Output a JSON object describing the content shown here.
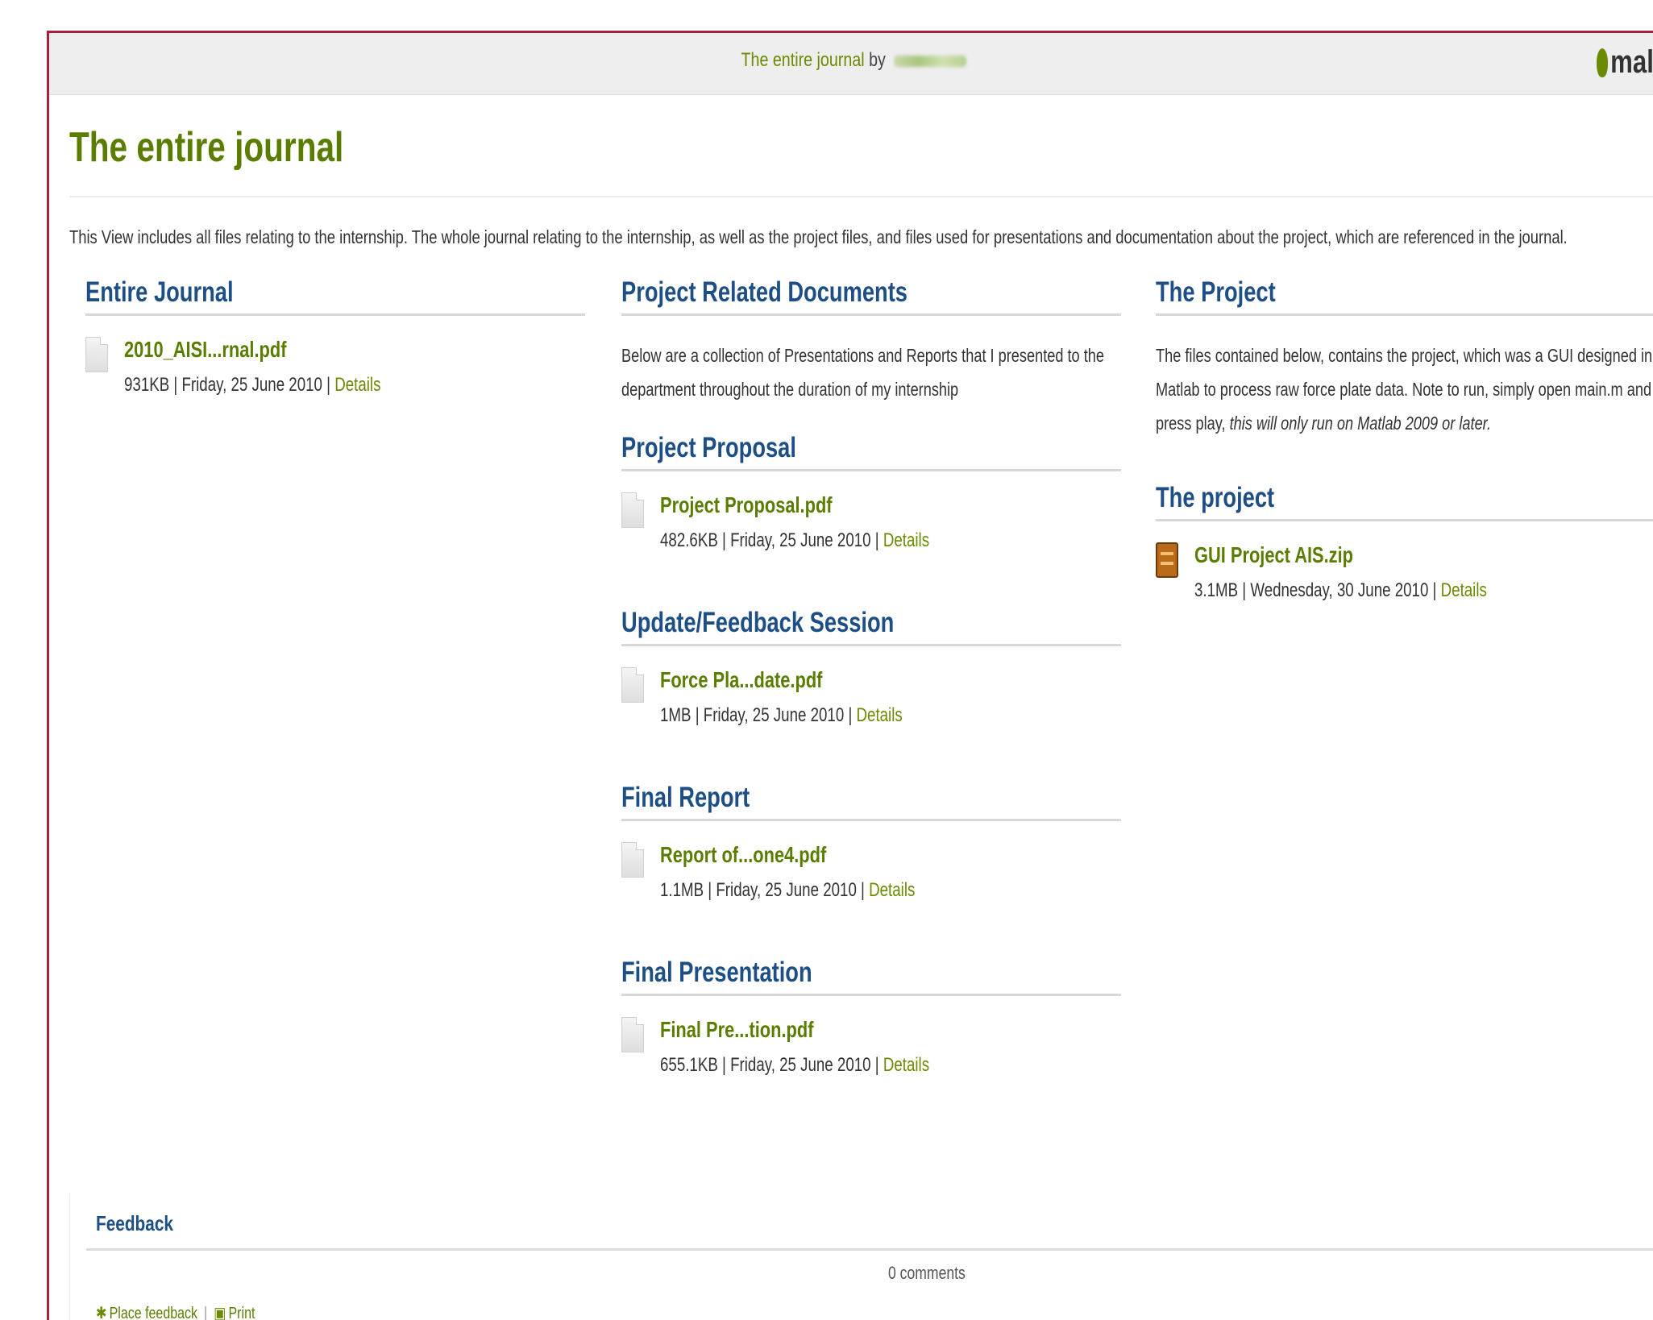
{
  "topbar": {
    "title_link": "The entire journal",
    "by_text": "by",
    "logo_text": "mal"
  },
  "page": {
    "title": "The entire journal",
    "intro": "This View includes all files relating to the internship. The whole journal relating to the internship, as well as the project files, and files used for presentations and documentation about the project, which are referenced in the journal."
  },
  "columns": {
    "col1": {
      "blocks": [
        {
          "title": "Entire Journal",
          "files": [
            {
              "name": "2010_AISI...rnal.pdf",
              "meta": "931KB | Friday, 25 June 2010 |",
              "details": "Details"
            }
          ]
        }
      ]
    },
    "col2": {
      "blocks": [
        {
          "title": "Project Related Documents",
          "text": "Below are a collection of Presentations and Reports that I presented to the department throughout the duration of my internship"
        },
        {
          "title": "Project Proposal",
          "files": [
            {
              "name": "Project Proposal.pdf",
              "meta": "482.6KB | Friday, 25 June 2010 |",
              "details": "Details"
            }
          ]
        },
        {
          "title": "Update/Feedback Session",
          "files": [
            {
              "name": "Force Pla...date.pdf",
              "meta": "1MB | Friday, 25 June 2010 |",
              "details": "Details"
            }
          ]
        },
        {
          "title": "Final Report",
          "files": [
            {
              "name": "Report of...one4.pdf",
              "meta": "1.1MB | Friday, 25 June 2010 |",
              "details": "Details"
            }
          ]
        },
        {
          "title": "Final Presentation",
          "files": [
            {
              "name": "Final Pre...tion.pdf",
              "meta": "655.1KB | Friday, 25 June 2010 |",
              "details": "Details"
            }
          ]
        }
      ]
    },
    "col3": {
      "blocks": [
        {
          "title": "The Project",
          "text": "The files contained below, contains the project, which was a GUI designed in Matlab to process raw force plate data. Note to run, simply open main.m and press play,",
          "text_italic": "this will only run on Matlab 2009 or later."
        },
        {
          "title": "The project",
          "files": [
            {
              "name": "GUI Project AIS.zip",
              "meta": "3.1MB | Wednesday, 30 June 2010 |",
              "details": "Details",
              "icon": "zip-icon"
            }
          ]
        }
      ]
    }
  },
  "feedback": {
    "title": "Feedback",
    "comments": "0 comments",
    "place_feedback": "Place feedback",
    "print": "Print"
  },
  "colors": {
    "frame": "#a5233a",
    "title_green": "#5a7d00",
    "heading_blue": "#1d4f86",
    "link_green": "#6a8a00"
  }
}
